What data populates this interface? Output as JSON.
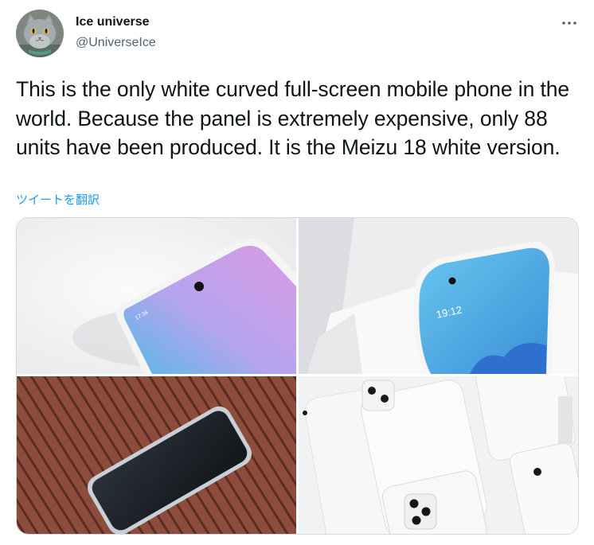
{
  "author": {
    "name": "Ice universe",
    "handle": "@UniverseIce"
  },
  "tweet": {
    "text": "This is the only white curved full-screen mobile phone in the world. Because the panel is extremely expensive, only 88 units have been produced. It is the Meizu 18 white version.",
    "translate_label": "ツイートを翻訳"
  },
  "media": {
    "photo1": {
      "screen_time": "17:36"
    },
    "photo2": {
      "screen_time": "19:12"
    }
  },
  "colors": {
    "text_primary": "#0f1419",
    "text_secondary": "#536471",
    "link": "#1d9bf0",
    "border": "#cfd9de"
  },
  "icons": [
    "avatar-cat",
    "more-dots-icon"
  ]
}
